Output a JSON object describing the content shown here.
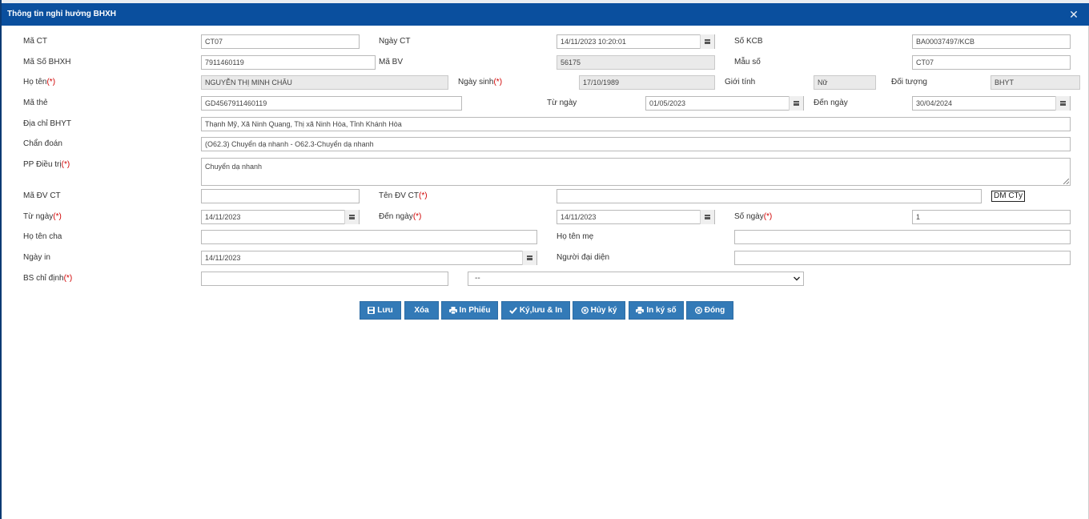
{
  "window": {
    "title": "Thông tin nghỉ hưởng BHXH",
    "close_glyph": "✕"
  },
  "form": {
    "ma_ct": {
      "label": "Mã CT",
      "value": "CT07"
    },
    "ngay_ct": {
      "label": "Ngày CT",
      "value": "14/11/2023 10:20:01"
    },
    "so_kcb": {
      "label": "Số KCB",
      "value": "BA00037497/KCB"
    },
    "ma_so_bhxh": {
      "label": "Mã Số BHXH",
      "value": "7911460119"
    },
    "ma_bv": {
      "label": "Mã BV",
      "value": "56175"
    },
    "mau_so": {
      "label": "Mẫu số",
      "value": "CT07"
    },
    "ho_ten": {
      "label": "Họ tên",
      "required": "(*)",
      "value": "NGUYỄN THỊ MINH CHÂU"
    },
    "ngay_sinh": {
      "label": "Ngày sinh",
      "required": "(*)",
      "value": "17/10/1989"
    },
    "gioi_tinh": {
      "label": "Giới tính",
      "value": "Nữ"
    },
    "doi_tuong": {
      "label": "Đối tượng",
      "value": "BHYT"
    },
    "ma_the": {
      "label": "Mã thẻ",
      "value": "GD4567911460119"
    },
    "tu_ngay_the": {
      "label": "Từ ngày",
      "value": "01/05/2023"
    },
    "den_ngay_the": {
      "label": "Đến ngày",
      "value": "30/04/2024"
    },
    "dia_chi": {
      "label": "Địa chỉ BHYT",
      "value": "Thạnh Mỹ, Xã Ninh Quang, Thị xã Ninh Hòa, Tỉnh Khánh Hòa"
    },
    "chan_doan": {
      "label": "Chẩn đoán",
      "value": "(O62.3) Chuyển dạ nhanh - O62.3-Chuyển dạ nhanh"
    },
    "pp_dieu_tri": {
      "label": "PP Điều trị",
      "required": "(*)",
      "value": "Chuyển dạ nhanh"
    },
    "ma_dv_ct": {
      "label": "Mã ĐV CT",
      "value": ""
    },
    "ten_dv_ct": {
      "label": "Tên ĐV CT",
      "required": "(*)",
      "value": ""
    },
    "dm_cty_label": "DM CTy",
    "tu_ngay": {
      "label": "Từ ngày",
      "required": "(*)",
      "value": "14/11/2023"
    },
    "den_ngay": {
      "label": "Đến ngày",
      "required": "(*)",
      "value": "14/11/2023"
    },
    "so_ngay": {
      "label": "Số ngày",
      "required": "(*)",
      "value": "1"
    },
    "ho_ten_cha": {
      "label": "Họ tên cha",
      "value": ""
    },
    "ho_ten_me": {
      "label": "Họ tên mẹ",
      "value": ""
    },
    "ngay_in": {
      "label": "Ngày in",
      "value": "14/11/2023"
    },
    "nguoi_dai_dien": {
      "label": "Người đại diện",
      "value": ""
    },
    "bs_chi_dinh": {
      "label": "BS chỉ định",
      "required": "(*)",
      "value": "",
      "select_value": "--"
    }
  },
  "buttons": {
    "luu": "Lưu",
    "xoa": "Xóa",
    "in_phieu": "In Phiếu",
    "ky_luu_in": "Ký,lưu & In",
    "huy_ky": "Hủy ký",
    "in_ky_so": "In ký số",
    "dong": "Đóng"
  },
  "colors": {
    "titlebar": "#0a4f9e",
    "button": "#337ab7",
    "required": "#d00000"
  }
}
